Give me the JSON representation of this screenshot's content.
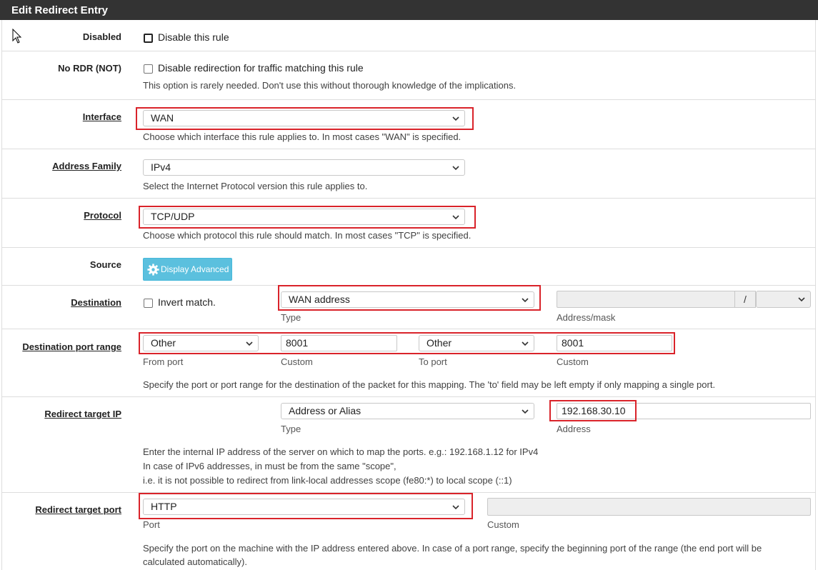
{
  "panel": {
    "title": "Edit Redirect Entry"
  },
  "disabled": {
    "label": "Disabled",
    "checkbox_label": "Disable this rule"
  },
  "nordr": {
    "label": "No RDR (NOT)",
    "checkbox_label": "Disable redirection for traffic matching this rule",
    "help": "This option is rarely needed. Don't use this without thorough knowledge of the implications."
  },
  "interface": {
    "label": "Interface",
    "value": "WAN",
    "help": "Choose which interface this rule applies to. In most cases \"WAN\" is specified."
  },
  "address_family": {
    "label": "Address Family",
    "value": "IPv4",
    "help": "Select the Internet Protocol version this rule applies to."
  },
  "protocol": {
    "label": "Protocol",
    "value": "TCP/UDP",
    "help": "Choose which protocol this rule should match. In most cases \"TCP\" is specified."
  },
  "source": {
    "label": "Source",
    "button": "Display Advanced"
  },
  "destination": {
    "label": "Destination",
    "invert_label": "Invert match.",
    "type_value": "WAN address",
    "type_sub": "Type",
    "slash": "/",
    "address_sub": "Address/mask"
  },
  "dest_port": {
    "label": "Destination port range",
    "from_value": "Other",
    "from_sub": "From port",
    "custom1_value": "8001",
    "custom1_sub": "Custom",
    "to_value": "Other",
    "to_sub": "To port",
    "custom2_value": "8001",
    "custom2_sub": "Custom",
    "help": "Specify the port or port range for the destination of the packet for this mapping. The 'to' field may be left empty if only mapping a single port."
  },
  "redirect_ip": {
    "label": "Redirect target IP",
    "type_value": "Address or Alias",
    "type_sub": "Type",
    "address_value": "192.168.30.10",
    "address_sub": "Address",
    "help1": "Enter the internal IP address of the server on which to map the ports. e.g.: 192.168.1.12 for IPv4",
    "help2": "In case of IPv6 addresses, in must be from the same \"scope\",",
    "help3": "i.e. it is not possible to redirect from link-local addresses scope (fe80:*) to local scope (::1)"
  },
  "redirect_port": {
    "label": "Redirect target port",
    "value": "HTTP",
    "port_sub": "Port",
    "custom_sub": "Custom",
    "help1": "Specify the port on the machine with the IP address entered above. In case of a port range, specify the beginning port of the range (the end port will be",
    "help2": "calculated automatically)."
  },
  "colors": {
    "highlight": "#d9232a",
    "info_button": "#5bc0de",
    "heading": "#333333"
  }
}
